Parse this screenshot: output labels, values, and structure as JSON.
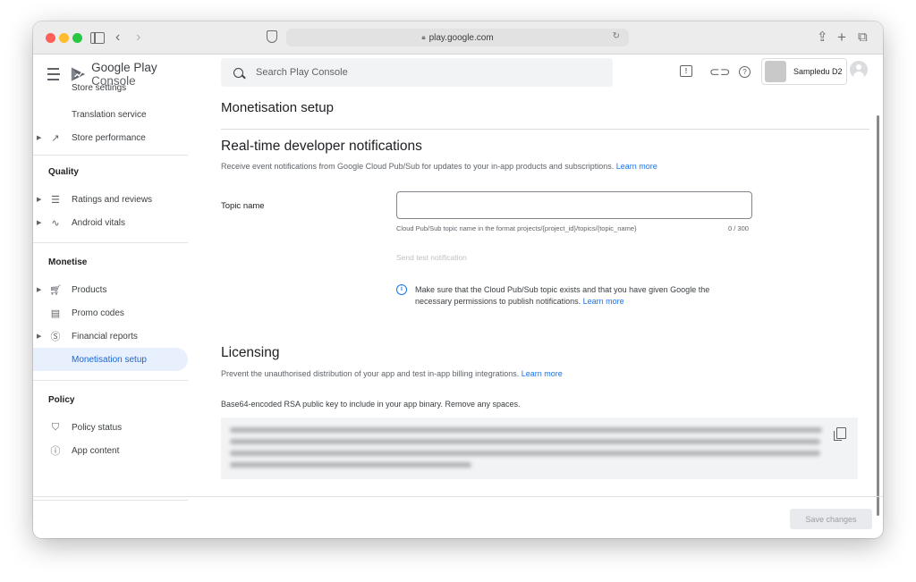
{
  "browser": {
    "url": "play.google.com"
  },
  "app": {
    "brand_main": "Google Play",
    "brand_sub": "Console"
  },
  "header": {
    "search_placeholder": "Search Play Console",
    "account_name": "Sampledu D2"
  },
  "sidebar": {
    "items_top": [
      {
        "label": "Store settings"
      },
      {
        "label": "Translation service"
      },
      {
        "label": "Store performance"
      }
    ],
    "section_quality": "Quality",
    "items_quality": [
      {
        "label": "Ratings and reviews"
      },
      {
        "label": "Android vitals"
      }
    ],
    "section_monetise": "Monetise",
    "items_monetise": [
      {
        "label": "Products"
      },
      {
        "label": "Promo codes"
      },
      {
        "label": "Financial reports"
      },
      {
        "label": "Monetisation setup"
      }
    ],
    "section_policy": "Policy",
    "items_policy": [
      {
        "label": "Policy status"
      },
      {
        "label": "App content"
      }
    ]
  },
  "main": {
    "page_title": "Monetisation setup",
    "rtdn": {
      "title": "Real-time developer notifications",
      "description": "Receive event notifications from Google Cloud Pub/Sub for updates to your in-app products and subscriptions.",
      "learn_more": "Learn more",
      "topic_label": "Topic name",
      "topic_value": "",
      "helper": "Cloud Pub/Sub topic name in the format projects/{project_id}/topics/{topic_name}",
      "counter": "0 / 300",
      "send_test": "Send test notification",
      "info_text": "Make sure that the Cloud Pub/Sub topic exists and that you have given Google the necessary permissions to publish notifications.",
      "info_link": "Learn more"
    },
    "licensing": {
      "title": "Licensing",
      "description": "Prevent the unauthorised distribution of your app and test in-app billing integrations.",
      "learn_more": "Learn more",
      "key_label": "Base64-encoded RSA public key to include in your app binary. Remove any spaces."
    }
  },
  "footer": {
    "save_label": "Save changes"
  }
}
